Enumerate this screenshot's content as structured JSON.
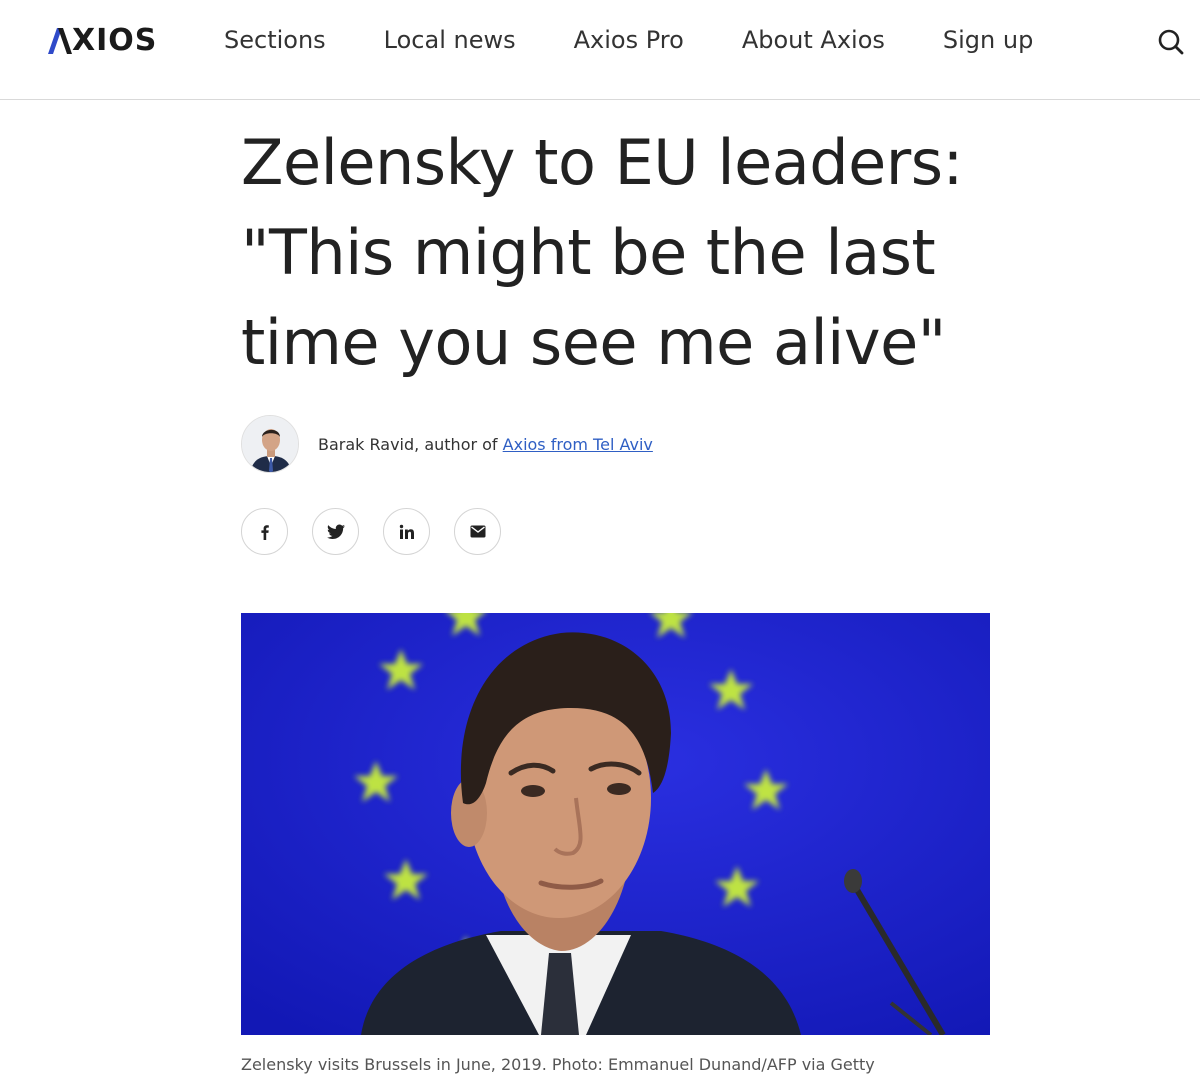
{
  "header": {
    "logo_text": "XIOS",
    "nav": [
      {
        "label": "Sections"
      },
      {
        "label": "Local news"
      },
      {
        "label": "Axios Pro"
      },
      {
        "label": "About Axios"
      },
      {
        "label": "Sign up"
      }
    ],
    "search_icon": "search-icon"
  },
  "article": {
    "headline_line1": "Zelensky to EU leaders:",
    "headline_line2": "\"This might be the last",
    "headline_line3": "time you see me alive\"",
    "byline": {
      "author_prefix": "Barak Ravid, author of ",
      "newsletter_link": "Axios from Tel Aviv"
    },
    "share_icons": [
      "facebook-icon",
      "twitter-icon",
      "linkedin-icon",
      "email-icon"
    ],
    "hero_caption": "Zelensky visits Brussels in June, 2019. Photo: Emmanuel Dunand/AFP via Getty"
  },
  "colors": {
    "link": "#2f5fc4",
    "eu_blue": "#1d22c9",
    "eu_star": "#c9ee3a",
    "text": "#222222"
  }
}
